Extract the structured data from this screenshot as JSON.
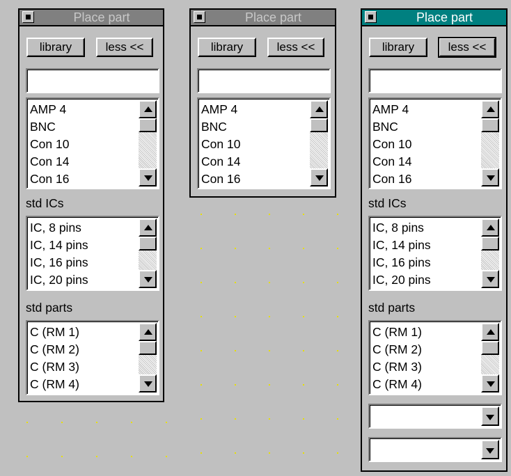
{
  "panels": [
    {
      "title": "Place part",
      "active": false,
      "library_label": "library",
      "less_label": "less <<",
      "search_value": "",
      "list1": [
        "AMP 4",
        "BNC",
        "Con 10",
        "Con 14",
        "Con 16"
      ],
      "section2_label": "std ICs",
      "list2": [
        "IC,  8 pins",
        "IC, 14 pins",
        "IC, 16 pins",
        "IC, 20 pins"
      ],
      "section3_label": "std parts",
      "list3": [
        "C (RM 1)",
        "C (RM 2)",
        "C (RM 3)",
        "C (RM 4)"
      ]
    },
    {
      "title": "Place part",
      "active": false,
      "library_label": "library",
      "less_label": "less <<",
      "search_value": "",
      "list1": [
        "AMP 4",
        "BNC",
        "Con 10",
        "Con 14",
        "Con 16"
      ]
    },
    {
      "title": "Place part",
      "active": true,
      "library_label": "library",
      "less_label": "less <<",
      "search_value": "",
      "list1": [
        "AMP 4",
        "BNC",
        "Con 10",
        "Con 14",
        "Con 16"
      ],
      "section2_label": "std ICs",
      "list2": [
        "IC,  8 pins",
        "IC, 14 pins",
        "IC, 16 pins",
        "IC, 20 pins"
      ],
      "section3_label": "std parts",
      "list3": [
        "C (RM 1)",
        "C (RM 2)",
        "C (RM 3)",
        "C (RM 4)"
      ],
      "combo1_value": "",
      "combo2_value": ""
    }
  ],
  "colors": {
    "active_title": "#008080",
    "inactive_title": "#808080",
    "background": "#c0c0c0",
    "grid_dot": "#e8e000"
  },
  "icons": [
    "system-menu-icon",
    "scroll-up-arrow-icon",
    "scroll-down-arrow-icon",
    "dropdown-arrow-icon"
  ]
}
